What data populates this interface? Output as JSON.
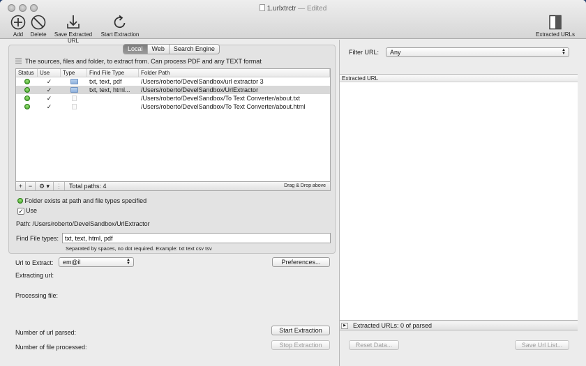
{
  "window": {
    "title": "1.urlxtrctr",
    "separator": "—",
    "edited": "Edited"
  },
  "toolbar": {
    "add_label": "Add",
    "delete_label": "Delete",
    "save_label": "Save Extracted URL",
    "start_label": "Start Extraction",
    "extracted_urls_label": "Extracted URLs"
  },
  "tabs": [
    {
      "label": "Local",
      "active": true
    },
    {
      "label": "Web",
      "active": false
    },
    {
      "label": "Search Engine",
      "active": false
    }
  ],
  "sources_info": "The sources, files and folder, to extract from. Can process PDF and any TEXT format",
  "table": {
    "headers": [
      "Status",
      "Use",
      "Type",
      "Find File Type",
      "Folder Path"
    ],
    "rows": [
      {
        "use": "✓",
        "type": "folder",
        "find": "txt, text, pdf",
        "path": "/Users/roberto/DevelSandbox/url extractor 3",
        "selected": false
      },
      {
        "use": "✓",
        "type": "folder",
        "find": "txt, text, html...",
        "path": "/Users/roberto/DevelSandbox/UrlExtractor",
        "selected": true
      },
      {
        "use": "✓",
        "type": "file",
        "find": "",
        "path": "/Users/roberto/DevelSandbox/To Text Converter/about.txt",
        "selected": false
      },
      {
        "use": "✓",
        "type": "file",
        "find": "",
        "path": "/Users/roberto/DevelSandbox/To Text Converter/about.html",
        "selected": false
      }
    ],
    "footer": {
      "plus": "+",
      "minus": "−",
      "gear": "⚙ ▾",
      "total": "Total paths: 4",
      "dragdrop": "Drag & Drop above"
    }
  },
  "detail": {
    "status_text": "Folder exists at path and file types specified",
    "use_label": "Use",
    "use_checked": "✓",
    "path_label": "Path:",
    "path_value": "/Users/roberto/DevelSandbox/UrlExtractor",
    "find_types_label": "Find File types:",
    "find_types_value": "txt, text, html, pdf",
    "find_types_hint": "Separated by spaces, no dot required. Example: txt text csv tsv"
  },
  "extraction": {
    "url_to_extract_label": "Url to Extract:",
    "url_to_extract_value": "em@il",
    "preferences_label": "Preferences...",
    "extracting_url_label": "Extracting url:",
    "processing_file_label": "Processing file:",
    "num_url_parsed_label": "Number of url parsed:",
    "num_file_processed_label": "Number of file processed:",
    "start_label": "Start Extraction",
    "stop_label": "Stop Extraction"
  },
  "results": {
    "filter_label": "Filter URL:",
    "filter_value": "Any",
    "column_header": "Extracted URL",
    "count_text": "Extracted URLs: 0 of   parsed",
    "reset_label": "Reset Data...",
    "save_list_label": "Save Url List..."
  }
}
